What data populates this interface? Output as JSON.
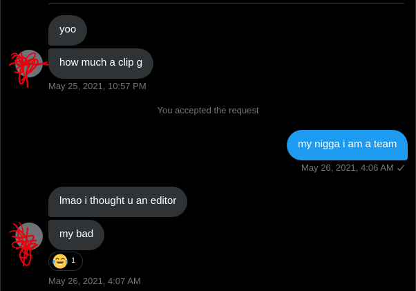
{
  "conversation": {
    "messages": [
      {
        "text": "yoo"
      },
      {
        "text": "how much a clip g"
      },
      {
        "text": "my nigga i am a team"
      },
      {
        "text": "lmao i thought u an editor"
      },
      {
        "text": "my bad"
      }
    ],
    "timestamps": {
      "first_group": "May 25, 2021, 10:57 PM",
      "outgoing": "May 26, 2021, 4:06 AM",
      "last_group": "May 26, 2021, 4:07 AM"
    },
    "system_message": "You accepted the request",
    "reaction": {
      "emoji_name": "face-with-tears-of-joy-icon",
      "count": "1"
    },
    "colors": {
      "incoming_bubble": "#2f3336",
      "outgoing_bubble": "#1d9bf0",
      "muted_text": "#71767b",
      "scribble": "#e8000b"
    }
  }
}
